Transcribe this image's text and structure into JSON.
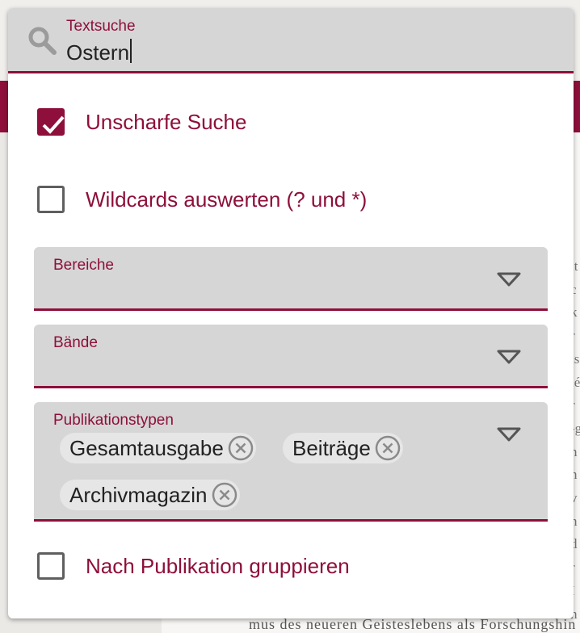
{
  "search": {
    "label": "Textsuche",
    "value": "Ostern"
  },
  "options": {
    "fuzzy": {
      "label": "Unscharfe Suche",
      "checked": true
    },
    "wildcards": {
      "label": "Wildcards auswerten (? und *)",
      "checked": false
    },
    "group": {
      "label": "Nach Publikation gruppieren",
      "checked": false
    }
  },
  "filters": {
    "bereiche": {
      "label": "Bereiche"
    },
    "baende": {
      "label": "Bände"
    },
    "publikationstypen": {
      "label": "Publikationstypen",
      "chips": [
        "Gesamtausgabe",
        "Beiträge",
        "Archivmagazin"
      ]
    }
  },
  "background": {
    "letters": "it\nc\nk\nr\nls\nié\nr\n-g\nn\nn\nv\nn\nd\nr\nI\nh",
    "bottom_line": "mus des neueren Geisteslebens als Forschungshin"
  },
  "colors": {
    "accent": "#8e0f3b",
    "field_bg": "#d6d6d6"
  }
}
